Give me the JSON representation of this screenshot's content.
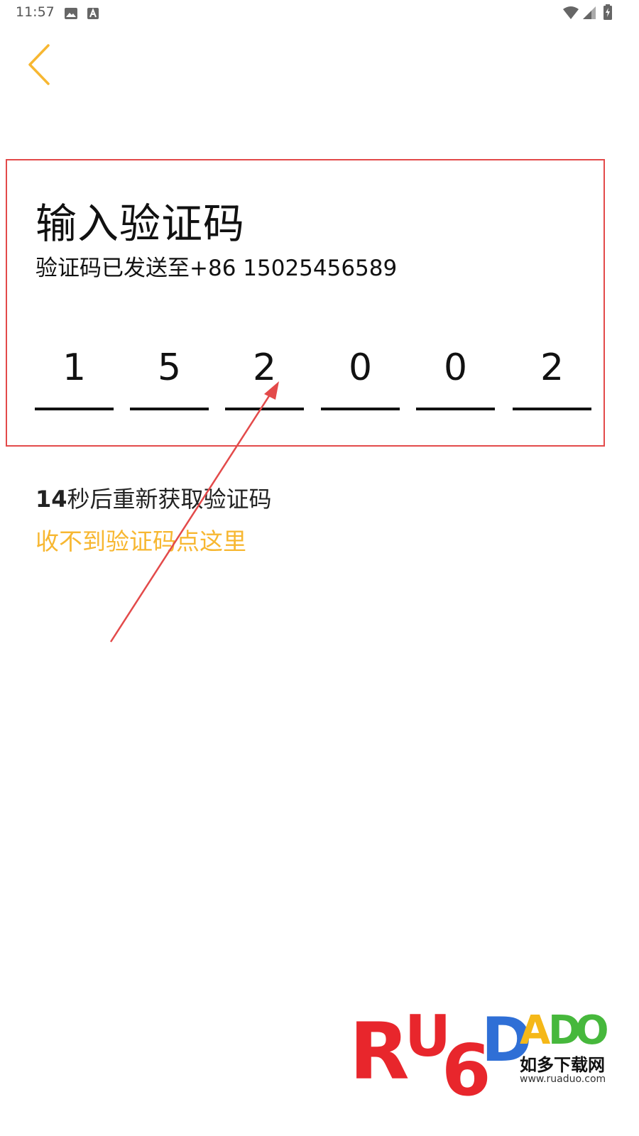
{
  "status_bar": {
    "time": "11:57",
    "left_icons": [
      "image-icon",
      "text-notification-icon"
    ],
    "right_icons": [
      "wifi-icon",
      "cellular-icon",
      "battery-charging-icon"
    ]
  },
  "nav": {
    "back_icon": "chevron-left-icon",
    "accent_color": "#f7b731"
  },
  "verify": {
    "title": "输入验证码",
    "subtitle": "验证码已发送至+86 15025456589",
    "code_digits": [
      "1",
      "5",
      "2",
      "0",
      "0",
      "2"
    ],
    "countdown_number": "14",
    "countdown_suffix": "秒后重新获取验证码",
    "help_link": "收不到验证码点这里"
  },
  "annotation": {
    "color": "#e34a4a"
  },
  "watermark": {
    "brand_letters": [
      "R",
      "U",
      "6",
      "D",
      "A",
      "D",
      "O"
    ],
    "brand_cn": "如多下载网",
    "url": "www.ruaduo.com"
  }
}
